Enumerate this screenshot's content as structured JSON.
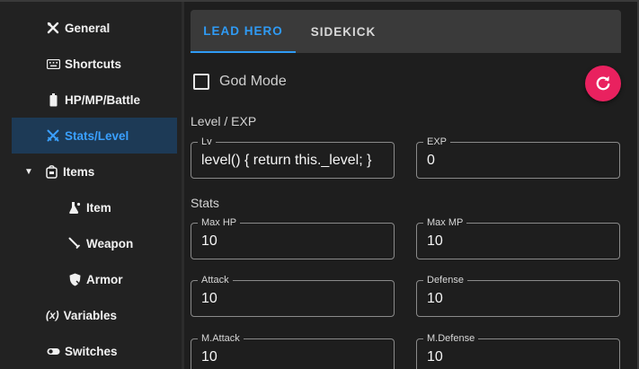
{
  "sidebar": {
    "items": [
      {
        "id": "general",
        "label": "General",
        "icon": "tools-icon"
      },
      {
        "id": "shortcuts",
        "label": "Shortcuts",
        "icon": "keyboard-icon"
      },
      {
        "id": "hpmpbattle",
        "label": "HP/MP/Battle",
        "icon": "battery-icon"
      },
      {
        "id": "statslevel",
        "label": "Stats/Level",
        "icon": "crossed-swords-icon",
        "active": true
      },
      {
        "id": "items",
        "label": "Items",
        "icon": "bag-icon",
        "expanded": true
      },
      {
        "id": "item",
        "label": "Item",
        "icon": "potion-icon"
      },
      {
        "id": "weapon",
        "label": "Weapon",
        "icon": "sword-icon"
      },
      {
        "id": "armor",
        "label": "Armor",
        "icon": "shield-icon"
      },
      {
        "id": "variables",
        "label": "Variables",
        "icon": "variable-icon",
        "icon_text": "(x)"
      },
      {
        "id": "switches",
        "label": "Switches",
        "icon": "toggle-icon"
      }
    ]
  },
  "tabs": [
    {
      "label": "LEAD HERO",
      "active": true
    },
    {
      "label": "SIDEKICK",
      "active": false
    }
  ],
  "god_mode": {
    "label": "God Mode",
    "checked": false
  },
  "reset_button_icon": "refresh-icon",
  "sections": {
    "level_exp": "Level / EXP",
    "stats": "Stats"
  },
  "fields": {
    "lv": {
      "label": "Lv",
      "value": "level() { return this._level; }"
    },
    "exp": {
      "label": "EXP",
      "value": "0"
    },
    "max_hp": {
      "label": "Max HP",
      "value": "10"
    },
    "max_mp": {
      "label": "Max MP",
      "value": "10"
    },
    "attack": {
      "label": "Attack",
      "value": "10"
    },
    "defense": {
      "label": "Defense",
      "value": "10"
    },
    "m_attack": {
      "label": "M.Attack",
      "value": "10"
    },
    "m_defense": {
      "label": "M.Defense",
      "value": "10"
    }
  },
  "colors": {
    "accent": "#2f9bf5",
    "active_bg": "#1d3a56",
    "fab": "#e9215f"
  }
}
